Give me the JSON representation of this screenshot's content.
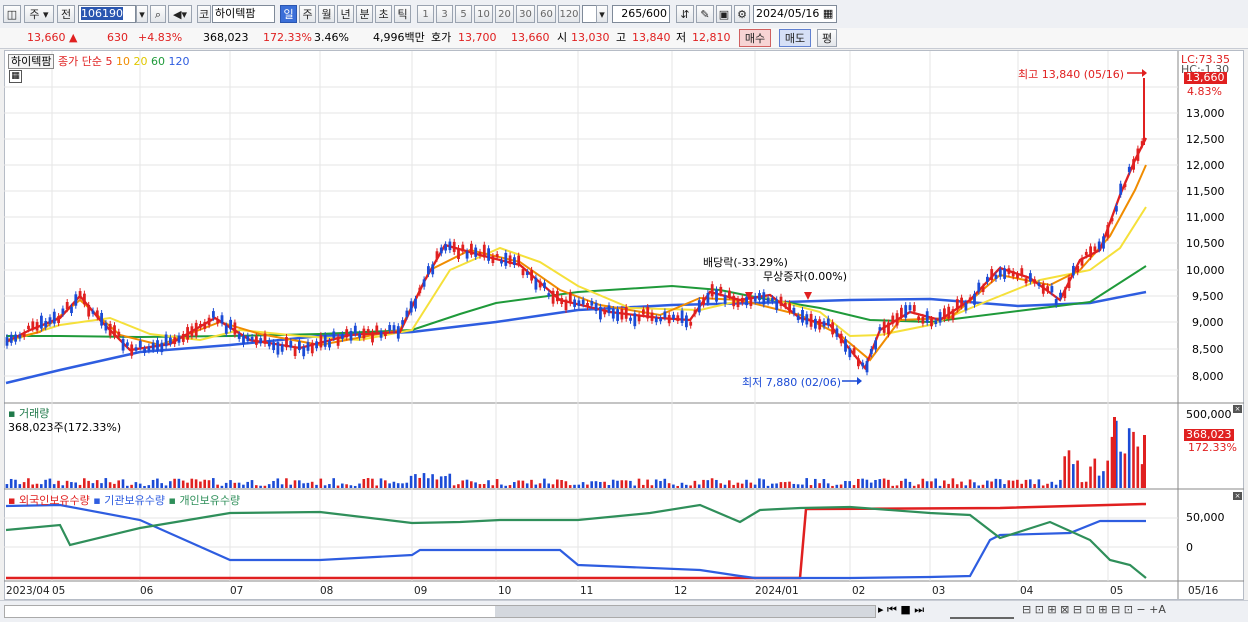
{
  "toolbar": {
    "period_type": "주",
    "period_prev": "전",
    "code": "106190",
    "name_prefix": "코",
    "stock_name": "하이텍팜",
    "periods": [
      "일",
      "주",
      "월",
      "년",
      "분",
      "초",
      "틱"
    ],
    "active_period": "일",
    "minute_ranges": [
      "1",
      "3",
      "5",
      "10",
      "20",
      "30",
      "60",
      "120"
    ],
    "count": "265",
    "count_max": "/600",
    "date": "2024/05/16"
  },
  "quote": {
    "price": "13,660",
    "up_symbol": "▲",
    "change": "630",
    "change_pct": "+4.83%",
    "volume": "368,023",
    "volume_ratio": "172.33%",
    "turnover": "3.46%",
    "amount": "4,996백만",
    "ask_label": "호가",
    "ask": "13,700",
    "bid": "13,660",
    "open_label": "시",
    "open": "13,030",
    "high_label": "고",
    "high": "13,840",
    "low_label": "저",
    "low": "12,810",
    "buy_label": "매수",
    "sell_label": "매도",
    "eval_label": "평"
  },
  "price_panel": {
    "legend_name": "하이텍팜",
    "ma_label": "종가 단순",
    "ma_periods": [
      "5",
      "10",
      "20",
      "60",
      "120"
    ],
    "ma_colors": [
      "#e02020",
      "#f08c00",
      "#f5e03a",
      "#1f9a3a",
      "#2e5de0"
    ],
    "lc": "LC:73.35",
    "hc": "HC:-1.30",
    "high_annot": "최고 13,840 (05/16)",
    "low_annot": "최저 7,880 (02/06)",
    "dividend_annot": "배당락(-33.29%)",
    "bonus_annot": "무상증자(0.00%)",
    "last_price_tag": "13,660",
    "last_pct_tag": "4.83%",
    "y_ticks": [
      "13,000",
      "12,500",
      "12,000",
      "11,500",
      "11,000",
      "10,500",
      "10,000",
      "9,500",
      "9,000",
      "8,500",
      "8,000"
    ]
  },
  "volume_panel": {
    "title": "거래량",
    "sub": "368,023주(172.33%)",
    "y_tick": "500,000",
    "last_tag": "368,023",
    "last_pct": "172.33%"
  },
  "holding_panel": {
    "legend": [
      "외국인보유수량",
      "기관보유수량",
      "개인보유수량"
    ],
    "colors": [
      "#e02020",
      "#2e5de0",
      "#2f8f5a"
    ],
    "y_ticks": [
      "50,000",
      "0"
    ]
  },
  "x_axis": {
    "labels": [
      "2023/04",
      "05",
      "06",
      "07",
      "08",
      "09",
      "10",
      "11",
      "12",
      "2024/01",
      "02",
      "03",
      "04",
      "05",
      "05/16"
    ]
  },
  "chart_data": {
    "type": "line",
    "title": "하이텍팜",
    "x": [
      "2023/04",
      "05",
      "06",
      "07",
      "08",
      "09",
      "10",
      "11",
      "12",
      "2024/01",
      "02",
      "03",
      "04",
      "05",
      "05/16"
    ],
    "series": [
      {
        "name": "종가",
        "values": [
          8600,
          9500,
          8500,
          8650,
          8700,
          10800,
          10200,
          9300,
          9000,
          9400,
          7900,
          9300,
          10200,
          11900,
          13660
        ]
      },
      {
        "name": "120",
        "values": [
          7900,
          8200,
          8450,
          8650,
          8750,
          8900,
          9150,
          9200,
          9250,
          9300,
          9300,
          9300,
          9350,
          9400,
          9600
        ]
      },
      {
        "name": "60",
        "values": [
          8800,
          8850,
          8850,
          8850,
          8900,
          9000,
          9400,
          9600,
          9700,
          9600,
          9100,
          9200,
          9300,
          9500,
          10100
        ]
      }
    ],
    "ylim": [
      7800,
      13900
    ],
    "grid": true
  }
}
